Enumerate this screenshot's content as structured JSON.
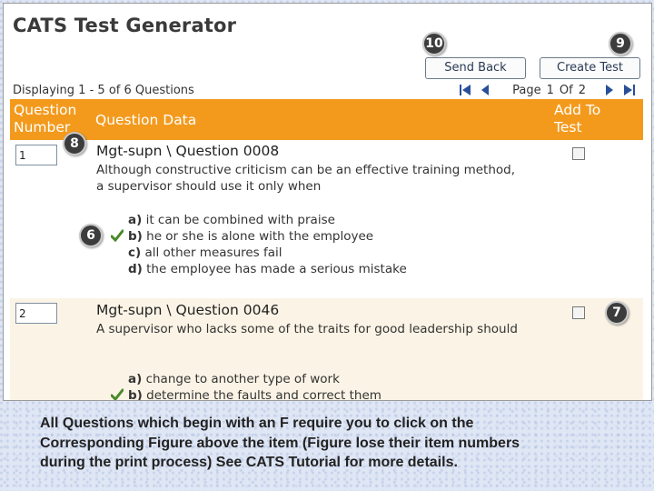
{
  "app_title": "CATS Test Generator",
  "buttons": {
    "send_back": "Send Back",
    "create_test": "Create Test"
  },
  "badges": {
    "b10": "10",
    "b9": "9",
    "b8": "8",
    "b6": "6",
    "b7": "7"
  },
  "displaying": {
    "prefix": "Displaying",
    "range": "1 - 5",
    "of_word": "of",
    "count": "6",
    "suffix": "Questions"
  },
  "pager": {
    "page_label": "Page",
    "current": "1",
    "of_label": "Of",
    "total": "2"
  },
  "table_header": {
    "question_number": "Question Number",
    "question_data": "Question Data",
    "add_to_test": "Add To Test"
  },
  "questions": [
    {
      "number": "1",
      "title": "Mgt-supn \\ Question 0008",
      "text": "Although constructive criticism can be an effective training method, a supervisor should use it only when",
      "answers": [
        {
          "letter": "a)",
          "text": "it can be combined with praise",
          "correct": false
        },
        {
          "letter": "b)",
          "text": "he or she is alone with the employee",
          "correct": true
        },
        {
          "letter": "c)",
          "text": "all other measures fail",
          "correct": false
        },
        {
          "letter": "d)",
          "text": "the employee has made a serious mistake",
          "correct": false
        }
      ]
    },
    {
      "number": "2",
      "title": "Mgt-supn \\ Question 0046",
      "text": "A supervisor who lacks some of the traits for good leadership should",
      "answers": [
        {
          "letter": "a)",
          "text": "change to another type of work",
          "correct": false
        },
        {
          "letter": "b)",
          "text": "determine the faults and correct them",
          "correct": true
        }
      ]
    }
  ],
  "caption": "All Questions which begin with an F require you to click on the Corresponding Figure above the item (Figure lose their item numbers during the print process)  See CATS Tutorial for more details.",
  "colors": {
    "header": "#f39a1d",
    "alt_row": "#fbf4e6",
    "check": "#4a8a2a"
  },
  "icons": [
    "first-page-icon",
    "prev-page-icon",
    "next-page-icon",
    "last-page-icon",
    "check-icon"
  ]
}
